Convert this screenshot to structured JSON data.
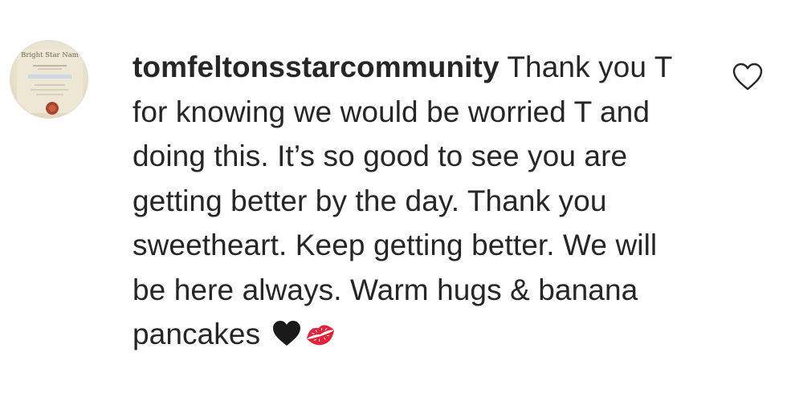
{
  "comment": {
    "username": "tomfeltonsstarcommunity",
    "text": "Thank you T for knowing we would be worried T and doing this. It’s so good to see you are getting better by the day. Thank you sweetheart. Keep getting better. We will be here always. Warm hugs & banana pancakes",
    "emojis": [
      "black-heart",
      "kiss-mark"
    ],
    "like_icon": "heart-outline-icon"
  },
  "avatar": {
    "certificate_title": "Bright Star Nam"
  },
  "colors": {
    "text": "#262626",
    "background": "#ffffff",
    "kiss_mark": "#e0243b"
  }
}
